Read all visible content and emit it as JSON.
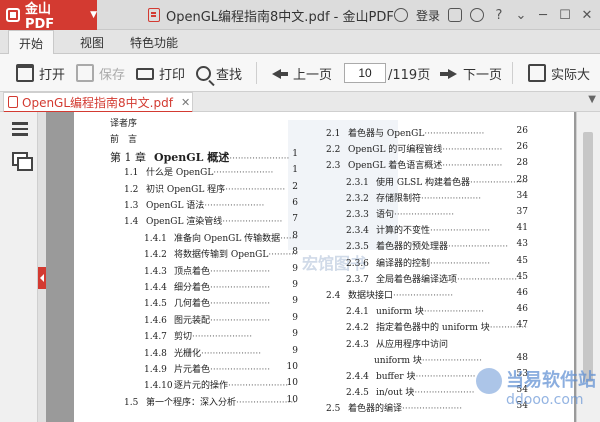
{
  "titlebar": {
    "app_name": "金山PDF",
    "document_title": "OpenGL编程指南8中文.pdf - 金山PDF",
    "login_label": "登录"
  },
  "menu": {
    "tabs": [
      {
        "label": "开始",
        "active": true
      },
      {
        "label": "视图",
        "active": false
      },
      {
        "label": "特色功能",
        "active": false
      }
    ]
  },
  "toolbar": {
    "open_label": "打开",
    "save_label": "保存",
    "print_label": "打印",
    "find_label": "查找",
    "prev_label": "上一页",
    "page_current": "10",
    "page_total_label": "/119页",
    "next_label": "下一页",
    "actual_label": "实际大"
  },
  "doctab": {
    "label": "OpenGL编程指南8中文.pdf"
  },
  "watermark": {
    "left_text": "宏馆图书",
    "brand_name": "当易软件站",
    "brand_url": "ddooo.com"
  },
  "toc_left": [
    {
      "num": "",
      "title": "译者序",
      "page": "",
      "level": 0
    },
    {
      "num": "",
      "title": "前　言",
      "page": "",
      "level": 0
    },
    {
      "num": "第 1 章",
      "title": "OpenGL 概述",
      "page": "1",
      "level": 1
    },
    {
      "num": "1.1",
      "title": "什么是 OpenGL",
      "page": "1",
      "level": 2
    },
    {
      "num": "1.2",
      "title": "初识 OpenGL 程序",
      "page": "2",
      "level": 2
    },
    {
      "num": "1.3",
      "title": "OpenGL 语法",
      "page": "6",
      "level": 2
    },
    {
      "num": "1.4",
      "title": "OpenGL 渲染管线",
      "page": "7",
      "level": 2
    },
    {
      "num": "1.4.1",
      "title": "准备向 OpenGL 传输数据",
      "page": "8",
      "level": 3
    },
    {
      "num": "1.4.2",
      "title": "将数据传输到 OpenGL",
      "page": "8",
      "level": 3
    },
    {
      "num": "1.4.3",
      "title": "顶点着色",
      "page": "9",
      "level": 3
    },
    {
      "num": "1.4.4",
      "title": "细分着色",
      "page": "9",
      "level": 3
    },
    {
      "num": "1.4.5",
      "title": "几何着色",
      "page": "9",
      "level": 3
    },
    {
      "num": "1.4.6",
      "title": "图元装配",
      "page": "9",
      "level": 3
    },
    {
      "num": "1.4.7",
      "title": "剪切",
      "page": "9",
      "level": 3
    },
    {
      "num": "1.4.8",
      "title": "光栅化",
      "page": "9",
      "level": 3
    },
    {
      "num": "1.4.9",
      "title": "片元着色",
      "page": "10",
      "level": 3
    },
    {
      "num": "1.4.10",
      "title": "逐片元的操作",
      "page": "10",
      "level": 3
    },
    {
      "num": "1.5",
      "title": "第一个程序：深入分析",
      "page": "10",
      "level": 2
    }
  ],
  "toc_right": [
    {
      "num": "2.1",
      "title": "着色器与 OpenGL",
      "page": "26",
      "level": 2
    },
    {
      "num": "2.2",
      "title": "OpenGL 的可编程管线",
      "page": "26",
      "level": 2
    },
    {
      "num": "2.3",
      "title": "OpenGL 着色语言概述",
      "page": "28",
      "level": 2
    },
    {
      "num": "2.3.1",
      "title": "使用 GLSL 构建着色器",
      "page": "28",
      "level": 3
    },
    {
      "num": "2.3.2",
      "title": "存储限制符",
      "page": "34",
      "level": 3
    },
    {
      "num": "2.3.3",
      "title": "语句",
      "page": "37",
      "level": 3
    },
    {
      "num": "2.3.4",
      "title": "计算的不变性",
      "page": "41",
      "level": 3
    },
    {
      "num": "2.3.5",
      "title": "着色器的预处理器",
      "page": "43",
      "level": 3
    },
    {
      "num": "2.3.6",
      "title": "编译器的控制",
      "page": "45",
      "level": 3
    },
    {
      "num": "2.3.7",
      "title": "全局着色器编译选项",
      "page": "45",
      "level": 3
    },
    {
      "num": "2.4",
      "title": "数据块接口",
      "page": "46",
      "level": 2
    },
    {
      "num": "2.4.1",
      "title": "uniform 块",
      "page": "46",
      "level": 3
    },
    {
      "num": "2.4.2",
      "title": "指定着色器中的 uniform 块",
      "page": "47",
      "level": 3
    },
    {
      "num": "2.4.3",
      "title": "从应用程序中访问",
      "page": "",
      "level": 3
    },
    {
      "num": "",
      "title": "uniform 块",
      "page": "48",
      "level": 4
    },
    {
      "num": "2.4.4",
      "title": "buffer 块",
      "page": "53",
      "level": 3
    },
    {
      "num": "2.4.5",
      "title": "in/out 块",
      "page": "54",
      "level": 3
    },
    {
      "num": "2.5",
      "title": "着色器的编译",
      "page": "54",
      "level": 2
    }
  ]
}
